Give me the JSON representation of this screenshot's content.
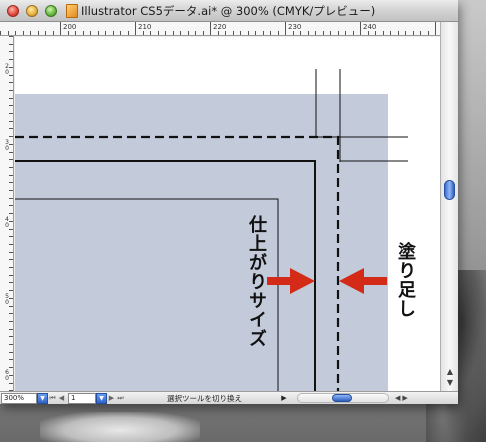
{
  "window": {
    "title": "Illustrator CS5データ.ai* @ 300% (CMYK/プレビュー)"
  },
  "rulers": {
    "top_labels": [
      "200",
      "210",
      "220",
      "230",
      "240"
    ],
    "left_labels": [
      {
        "main": "2",
        "sub": "0"
      },
      {
        "main": "3",
        "sub": "0"
      },
      {
        "main": "4",
        "sub": "0"
      },
      {
        "main": "5",
        "sub": "0"
      },
      {
        "main": "6",
        "sub": "0"
      }
    ]
  },
  "canvas": {
    "finished_size_label": "仕上がりサイズ",
    "bleed_label": "塗り足し",
    "colors": {
      "bleed_fill": "#c3cbdb",
      "arrow": "#d42a18",
      "guide_line": "#111111"
    }
  },
  "statusbar": {
    "zoom_value": "300%",
    "page_value": "1",
    "tool_status": "選択ツールを切り換え"
  },
  "icons": {
    "close": "close-icon",
    "minimize": "minimize-icon",
    "zoom": "zoom-icon",
    "document": "illustrator-document-icon"
  }
}
